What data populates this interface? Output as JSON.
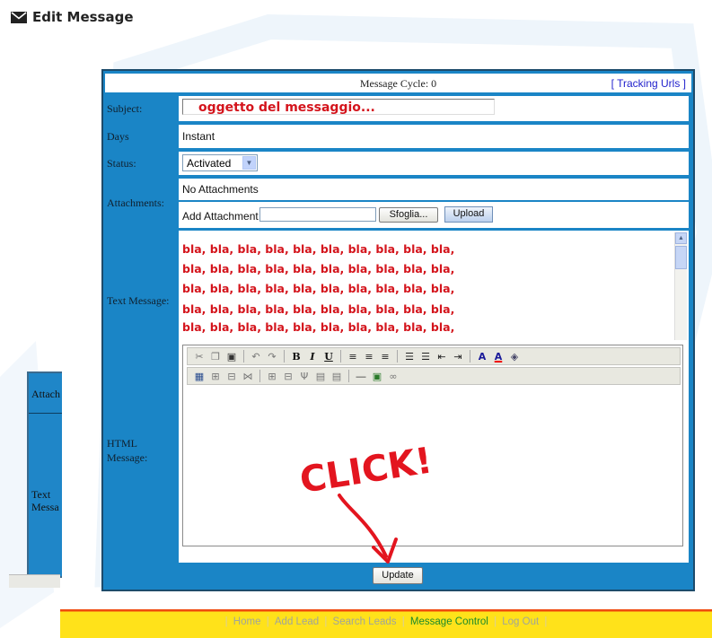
{
  "page": {
    "title": "Edit Message",
    "title_icon": "envelope-icon"
  },
  "background_panel": {
    "labels": [
      "Attach",
      "Text Messa"
    ]
  },
  "form": {
    "message_cycle": "Message Cycle: 0",
    "tracking_urls": "[ Tracking Urls ]",
    "subject": {
      "label": "Subject:",
      "value": "oggetto del messaggio..."
    },
    "days": {
      "label": "Days",
      "value": "Instant"
    },
    "status": {
      "label": "Status:",
      "value": "Activated"
    },
    "attachments": {
      "label": "Attachments:",
      "none_text": "No Attachments",
      "add_label": "Add Attachment",
      "browse_label": "Sfoglia...",
      "upload_label": "Upload"
    },
    "text_message": {
      "label": "Text Message:",
      "lines": [
        "bla, bla, bla, bla, bla, bla, bla, bla, bla, bla,",
        "bla, bla, bla, bla, bla, bla, bla, bla, bla, bla,",
        "bla, bla, bla, bla, bla, bla, bla, bla, bla, bla,",
        "bla, bla, bla, bla, bla, bla, bla, bla, bla, bla,",
        "bla, bla, bla, bla, bla, bla, bla, bla, bla, bla,"
      ]
    },
    "html_message": {
      "label": "HTML Message:",
      "toolbar_row1": {
        "bold": "B",
        "italic": "I",
        "underline": "U",
        "font_color": "A",
        "highlight": "A"
      }
    },
    "update_label": "Update"
  },
  "annotation": {
    "text": "CLICK!",
    "color": "#e3151f"
  },
  "nav": {
    "items": [
      "Home",
      "Add Lead",
      "Search Leads",
      "Message Control",
      "Log Out"
    ],
    "active": "Message Control"
  },
  "colors": {
    "panel": "#1a85c6",
    "label_text": "#10202e",
    "accent_red": "#d4141c",
    "nav_active": "#1a8a2a"
  }
}
